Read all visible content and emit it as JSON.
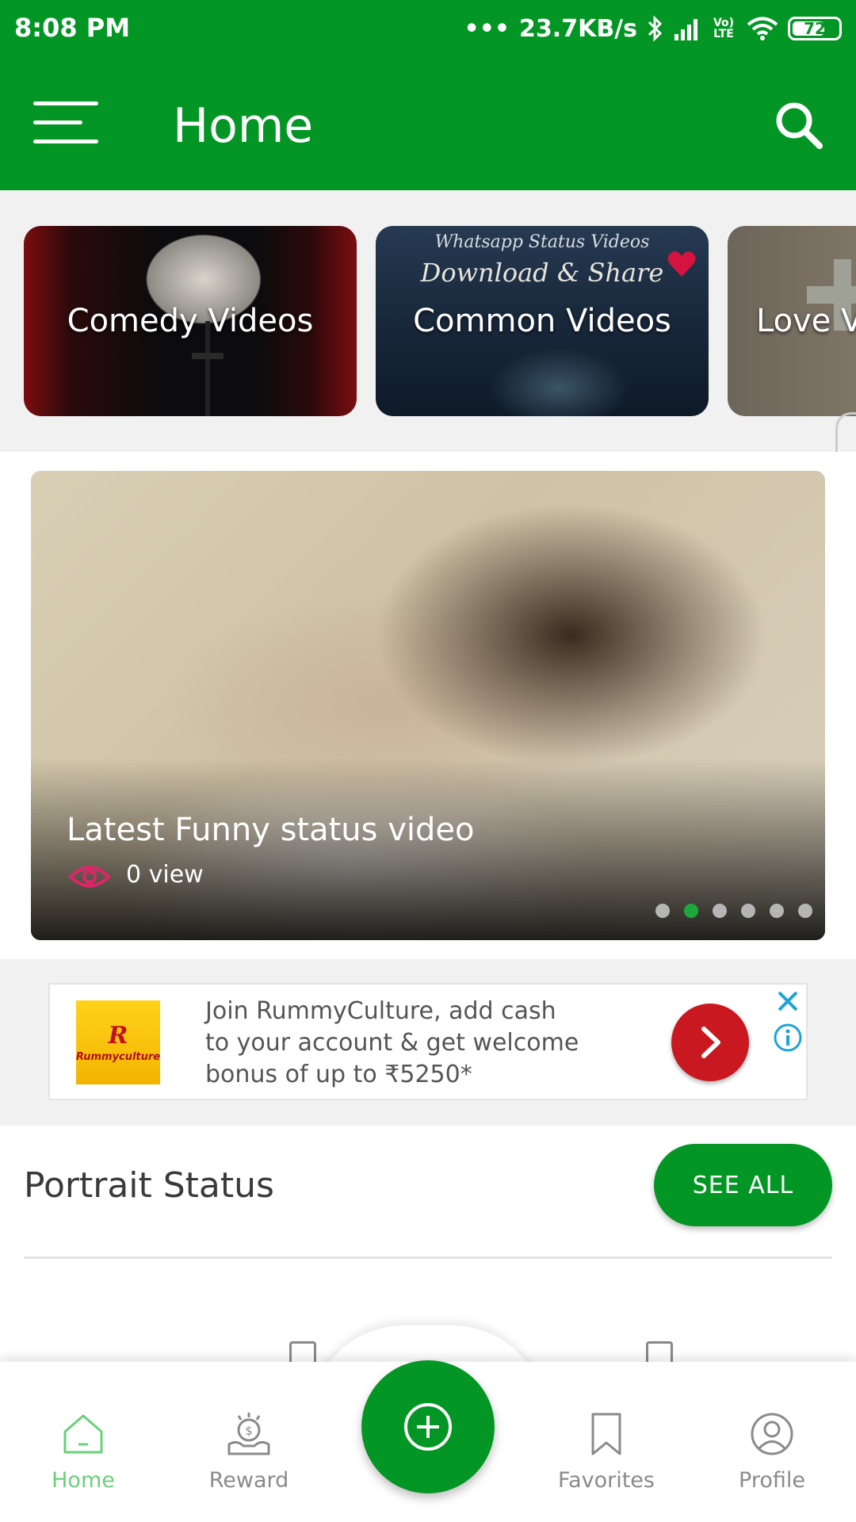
{
  "status_bar": {
    "time": "8:08 PM",
    "network_speed": "23.7KB/s",
    "battery": "72",
    "battery_level": 0.72,
    "volte": "Vo) LTE"
  },
  "app_bar": {
    "title": "Home",
    "menu_icon": "hamburger-menu-icon",
    "search_icon": "search-icon"
  },
  "categories": [
    {
      "label": "Comedy Videos"
    },
    {
      "label": "Common Videos",
      "watermark_top": "Whatsapp Status Videos",
      "watermark_main": "Download & Share"
    },
    {
      "label": "Love V"
    }
  ],
  "featured": {
    "title": "Latest Funny status video",
    "views": "0 view",
    "dots_count": 6,
    "active_dot": 1
  },
  "ad": {
    "brand": "Rummyculture",
    "logo_mark": "R",
    "text": "Join RummyCulture, add cash to your account & get welcome bonus of up to ₹5250*"
  },
  "section": {
    "title": "Portrait Status",
    "see_all": "SEE ALL"
  },
  "bottom_nav": {
    "home": "Home",
    "reward": "Reward",
    "favorites": "Favorites",
    "profile": "Profile"
  },
  "colors": {
    "primary": "#039624",
    "active_nav": "#6bd07a",
    "ad_button": "#c91820",
    "eye_icon": "#e0246a"
  }
}
